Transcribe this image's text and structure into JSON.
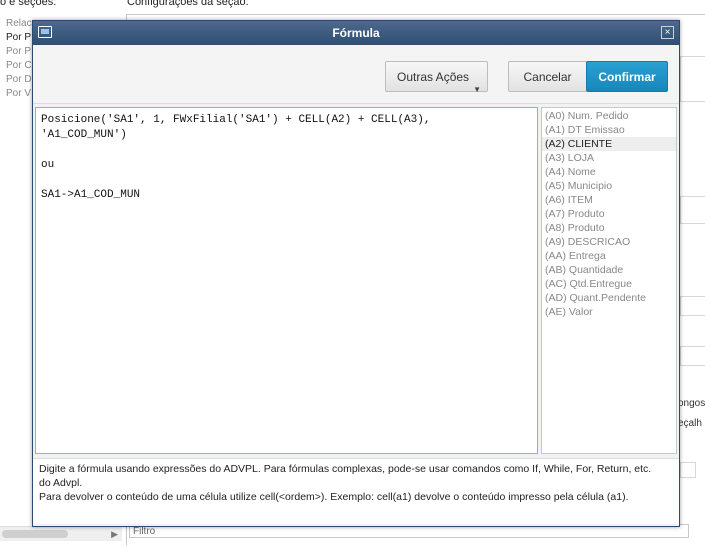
{
  "background": {
    "left_title": "o e seções:",
    "right_title": "Configurações da seção:",
    "tree_items": [
      "Relac",
      "Por P",
      "Por P",
      "Por C",
      "Por D",
      "Por V"
    ],
    "right_partial_1": "ongos",
    "right_partial_2": "eçalh",
    "filter_label": "Filtro"
  },
  "dialog": {
    "title": "Fórmula",
    "close_label": "×",
    "buttons": {
      "outras_acoes": "Outras Ações",
      "cancelar": "Cancelar",
      "confirmar": "Confirmar"
    },
    "editor_lines": [
      "Posicione('SA1', 1, FWxFilial('SA1') + CELL(A2) + CELL(A3),",
      "'A1_COD_MUN')",
      "",
      "ou",
      "",
      "SA1->A1_COD_MUN"
    ],
    "fields": [
      "(A0) Num. Pedido",
      "(A1) DT Emissao",
      "(A2) CLIENTE",
      "(A3) LOJA",
      "(A4) Nome",
      "(A5) Municipio",
      "(A6) ITEM",
      "(A7) Produto",
      "(A8) Produto",
      "(A9) DESCRICAO",
      "(AA) Entrega",
      "(AB) Quantidade",
      "(AC) Qtd.Entregue",
      "(AD) Quant.Pendente",
      "(AE) Valor"
    ],
    "selected_field": "(A2) CLIENTE",
    "help_lines": [
      "Digite a fórmula usando expressões do ADVPL. Para fórmulas complexas, pode-se usar comandos como If, While, For, Return, etc.",
      "do Advpl.",
      "Para devolver o conteúdo de uma célula utilize cell(<ordem>). Exemplo: cell(a1) devolve o conteúdo impresso pela célula (a1)."
    ]
  },
  "colors": {
    "titlebar": "#3b5a80",
    "confirm_button": "#1f95c9",
    "editor_border": "#7fb6d9"
  }
}
